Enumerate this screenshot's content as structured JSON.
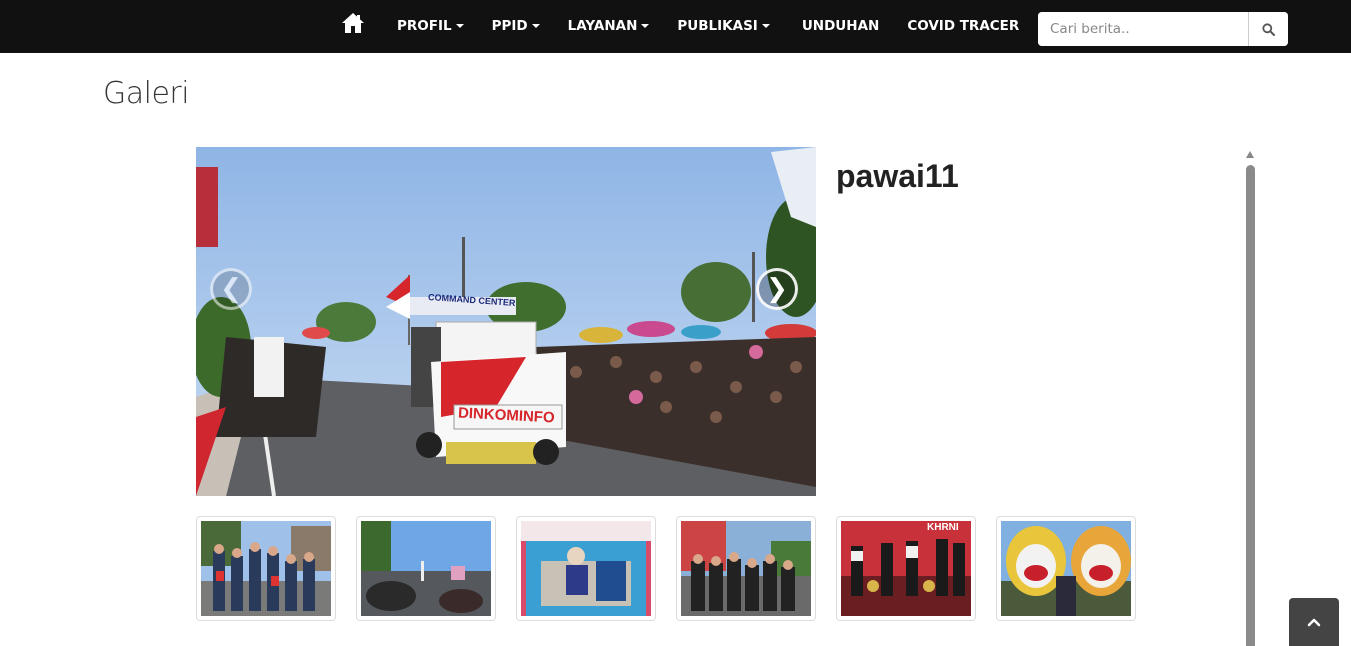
{
  "navbar": {
    "home_icon": "home-icon",
    "items": [
      {
        "label": "PROFIL",
        "dropdown": true
      },
      {
        "label": "PPID",
        "dropdown": true
      },
      {
        "label": "LAYANAN",
        "dropdown": true
      },
      {
        "label": "PUBLIKASI",
        "dropdown": true
      },
      {
        "label": "UNDUHAN",
        "dropdown": false
      },
      {
        "label": "COVID TRACER",
        "dropdown": false
      }
    ],
    "search": {
      "placeholder": "Cari berita..",
      "value": "",
      "icon": "search-icon"
    }
  },
  "page": {
    "title": "Galeri"
  },
  "gallery": {
    "current_title": "pawai11",
    "main_photo_truck_banner": "DINKOMINFO",
    "main_photo_truck_sign": "COMMAND CENTER",
    "thumb5_banner": "KHRNI",
    "prev_icon": "chevron-left-icon",
    "next_icon": "chevron-right-icon",
    "prev_symbol": "❮",
    "next_symbol": "❯",
    "thumbnails_count": 6
  },
  "colors": {
    "navbar_bg": "#111111",
    "nav_text": "#ffffff",
    "title_text": "#333333",
    "scrollbar": "#8a8a8a",
    "back_to_top_bg": "#444444"
  },
  "back_to_top": {
    "icon": "chevron-up-icon"
  }
}
